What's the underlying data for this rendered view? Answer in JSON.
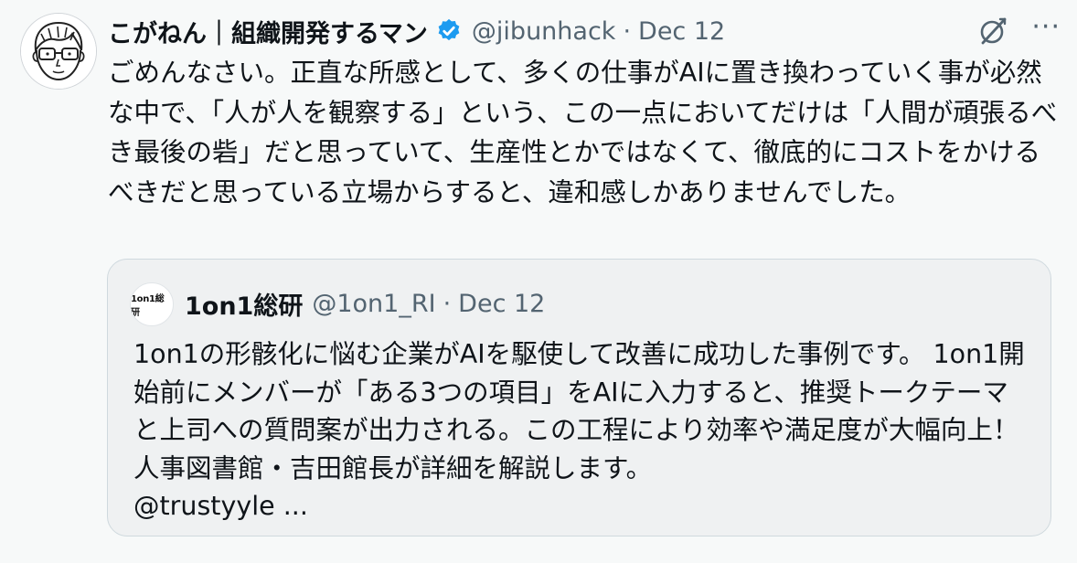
{
  "tweet": {
    "author_name": "こがねん｜組織開発するマン",
    "handle": "@jibunhack",
    "separator": "·",
    "date": "Dec 12",
    "body": "ごめんなさい。正直な所感として、多くの仕事がAIに置き換わっていく事が必然な中で、「人が人を観察する」という、この一点においてだけは「人間が頑張るべき最後の砦」だと思っていて、生産性とかではなくて、徹底的にコストをかけるべきだと思っている立場からすると、違和感しかありませんでした。",
    "more_label": "···",
    "icons": {
      "avatar": "illustrated-man-avatar",
      "verified": "verified-badge-icon",
      "ai": "grok-icon",
      "more": "more-options-icon"
    },
    "colors": {
      "verified": "#1d9bf0",
      "secondary_text": "#536471",
      "background": "#f7f9f9"
    }
  },
  "quote": {
    "avatar_text": "1on1総研",
    "author_name": "1on1総研",
    "handle": "@1on1_RI",
    "separator": "·",
    "date": "Dec 12",
    "body": "1on1の形骸化に悩む企業がAIを駆使して改善に成功した事例です。 1on1開始前にメンバーが「ある3つの項目」をAIに入力すると、推奨トークテーマと上司への質問案が出力される。この工程により効率や満足度が大幅向上！ 人事図書館・吉田館長が詳細を解説します。\n@trustyyle ..."
  }
}
